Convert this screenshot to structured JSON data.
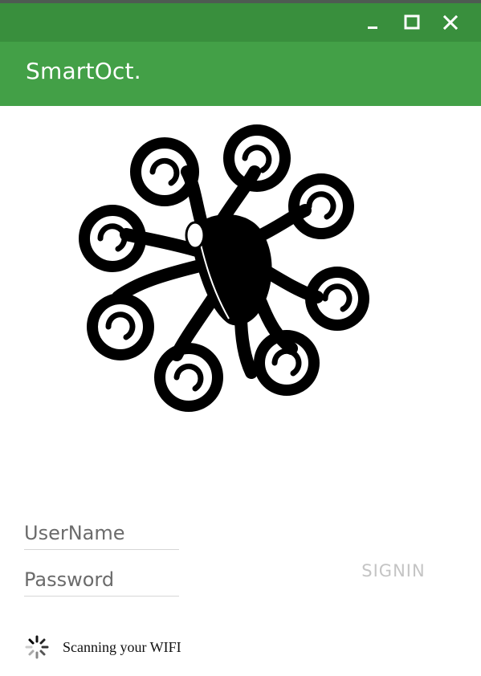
{
  "window": {
    "controls": [
      {
        "name": "minimize-button",
        "icon": "minimize-icon"
      },
      {
        "name": "maximize-button",
        "icon": "maximize-icon"
      },
      {
        "name": "close-button",
        "icon": "close-icon"
      }
    ],
    "titlebar_color": "#398f3d"
  },
  "app": {
    "title": "SmartOct.",
    "appbar_color": "#43a047",
    "logo_icon": "octopus-logo-icon"
  },
  "form": {
    "username_placeholder": "UserName",
    "password_placeholder": "Password",
    "signin_label": "SIGNIN"
  },
  "status": {
    "icon": "loading-spinner-icon",
    "text": "Scanning your WIFI"
  }
}
